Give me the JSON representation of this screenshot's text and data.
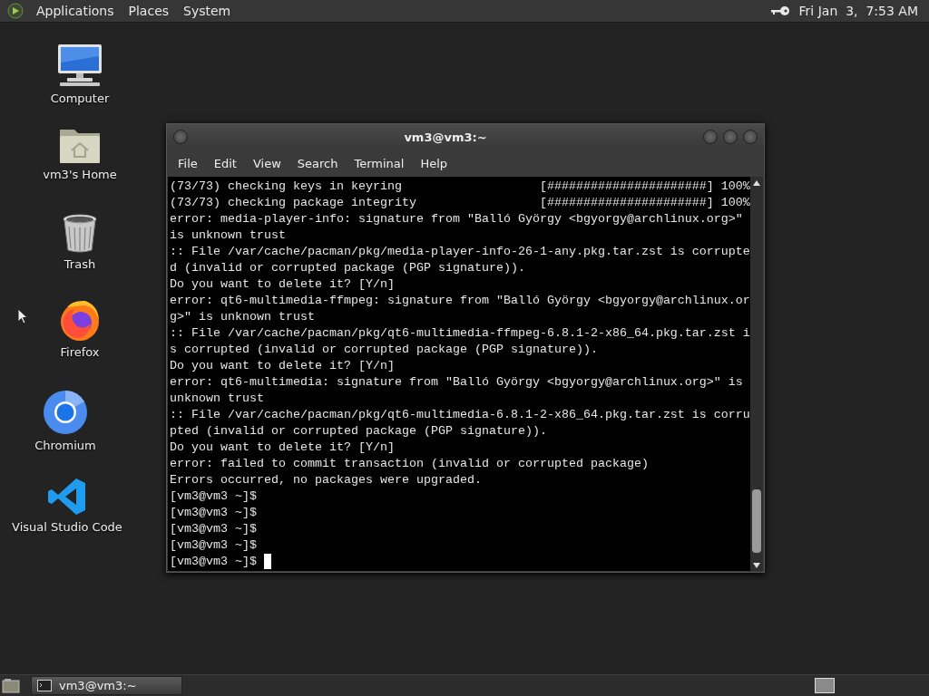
{
  "top_panel": {
    "menus": [
      "Applications",
      "Places",
      "System"
    ],
    "clock": "Fri Jan  3,  7:53 AM"
  },
  "desktop_icons": [
    {
      "kind": "computer",
      "label": "Computer"
    },
    {
      "kind": "home",
      "label": "vm3's Home"
    },
    {
      "kind": "trash",
      "label": "Trash"
    },
    {
      "kind": "firefox",
      "label": "Firefox"
    },
    {
      "kind": "chromium",
      "label": "Chromium"
    },
    {
      "kind": "vscode",
      "label": "Visual Studio Code"
    }
  ],
  "terminal": {
    "title": "vm3@vm3:~",
    "menu": [
      "File",
      "Edit",
      "View",
      "Search",
      "Terminal",
      "Help"
    ],
    "lines": [
      "(73/73) checking keys in keyring                   [######################] 100%",
      "(73/73) checking package integrity                 [######################] 100%",
      "error: media-player-info: signature from \"Balló György <bgyorgy@archlinux.org>\"",
      "is unknown trust",
      ":: File /var/cache/pacman/pkg/media-player-info-26-1-any.pkg.tar.zst is corrupte",
      "d (invalid or corrupted package (PGP signature)).",
      "Do you want to delete it? [Y/n]",
      "error: qt6-multimedia-ffmpeg: signature from \"Balló György <bgyorgy@archlinux.or",
      "g>\" is unknown trust",
      ":: File /var/cache/pacman/pkg/qt6-multimedia-ffmpeg-6.8.1-2-x86_64.pkg.tar.zst i",
      "s corrupted (invalid or corrupted package (PGP signature)).",
      "Do you want to delete it? [Y/n]",
      "error: qt6-multimedia: signature from \"Balló György <bgyorgy@archlinux.org>\" is",
      "unknown trust",
      ":: File /var/cache/pacman/pkg/qt6-multimedia-6.8.1-2-x86_64.pkg.tar.zst is corru",
      "pted (invalid or corrupted package (PGP signature)).",
      "Do you want to delete it? [Y/n]",
      "error: failed to commit transaction (invalid or corrupted package)",
      "Errors occurred, no packages were upgraded.",
      "[vm3@vm3 ~]$",
      "[vm3@vm3 ~]$",
      "[vm3@vm3 ~]$",
      "[vm3@vm3 ~]$",
      "[vm3@vm3 ~]$"
    ]
  },
  "taskbar": {
    "windows": [
      {
        "title": "vm3@vm3:~",
        "selected": true
      }
    ]
  }
}
